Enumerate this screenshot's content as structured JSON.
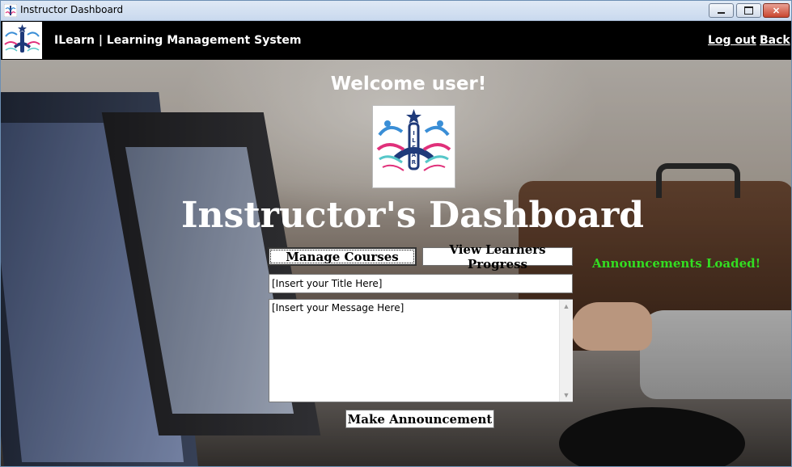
{
  "window": {
    "title": "Instructor Dashboard",
    "controls": {
      "minimize": "▭",
      "maximize": "▢",
      "close": "✕"
    }
  },
  "header": {
    "brand": "ILearn | Learning Management System",
    "logout_label": "Log out",
    "back_label": "Back"
  },
  "main": {
    "welcome": "Welcome user!",
    "title": "Instructor's Dashboard",
    "buttons": {
      "manage_courses": "Manage Courses",
      "view_progress": "View Learners Progress",
      "make_announcement": "Make Announcement"
    },
    "announcement_status": "Announcements Loaded!",
    "title_input_value": "[Insert your Title Here]",
    "message_input_value": "[Insert your Message Here]"
  },
  "logo": {
    "letters": "ILEARN",
    "colors": {
      "navy": "#1f3a7a",
      "blue": "#3a8ed6",
      "pink": "#e0307a",
      "teal": "#56c7c9"
    }
  },
  "colors": {
    "header_bg": "#000000",
    "status_green": "#33dd22",
    "text_white": "#ffffff"
  }
}
